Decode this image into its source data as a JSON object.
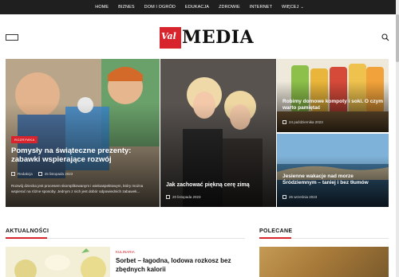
{
  "topnav": {
    "items": [
      "HOME",
      "BIZNES",
      "DOM I OGRÓD",
      "EDUKACJA",
      "ZDROWIE",
      "INTERNET",
      "WIĘCEJ"
    ]
  },
  "logo": {
    "mark": "Val",
    "word": "MEDIA"
  },
  "icons": {
    "menu": "hamburger-icon",
    "search": "search-icon",
    "user": "user-icon",
    "calendar": "calendar-icon"
  },
  "colors": {
    "accent": "#d8252d",
    "nav_bg": "#1f1f1f"
  },
  "hero": {
    "main": {
      "category": "ROZRYWKA",
      "title": "Pomysły na świąteczne prezenty: zabawki wspierające rozwój",
      "author": "Redakcja",
      "date": "25 listopada 2023",
      "excerpt": "Rozwój dziecka jest procesem skomplikowanym i wieloaspektowym, który można wspierać na różne sposoby. Jednym z nich jest dobór odpowiednich zabawek..."
    },
    "middle": {
      "title": "Jak zachować piękną cerę zimą",
      "date": "20 listopada 2023"
    },
    "right_top": {
      "title": "Robimy domowe kompoty i soki. O czym warto pamiętać",
      "date": "24 października 2023"
    },
    "right_bottom": {
      "title": "Jesienne wakacje nad morze Śródziemnym – taniej i bez tłumów",
      "date": "26 września 2023"
    }
  },
  "sections": {
    "news": {
      "title": "AKTUALNOŚCI",
      "item": {
        "category": "KULINARIA",
        "title": "Sorbet – łagodna, lodowa rozkosz bez zbędnych kalorii"
      }
    },
    "recommended": {
      "title": "POLECANE"
    }
  }
}
